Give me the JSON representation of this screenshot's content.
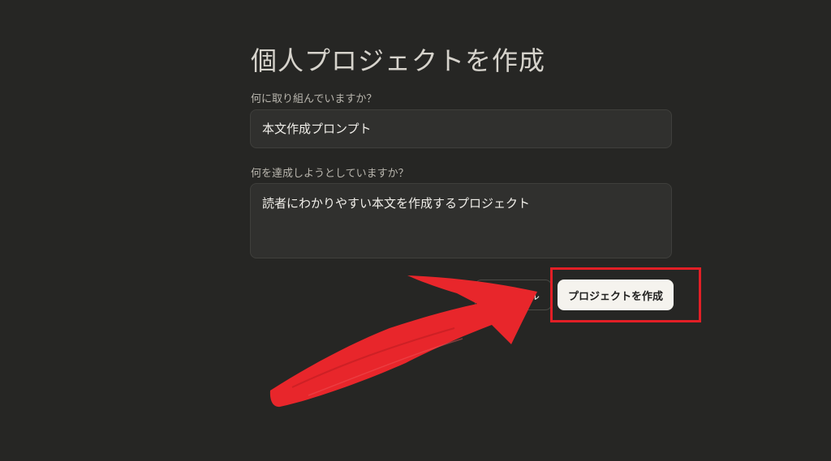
{
  "dialog": {
    "title": "個人プロジェクトを作成",
    "name_label": "何に取り組んでいますか？",
    "name_value": "本文作成プロンプト",
    "goal_label": "何を達成しようとしていますか？",
    "goal_value": "読者にわかりやすい本文を作成するプロジェクト",
    "cancel_label": "キャンセル",
    "create_label": "プロジェクトを作成"
  },
  "annotation": {
    "highlight_color": "#e21f26",
    "arrow_color": "#e8262b",
    "arrow_icon": "red-arrow-icon"
  }
}
